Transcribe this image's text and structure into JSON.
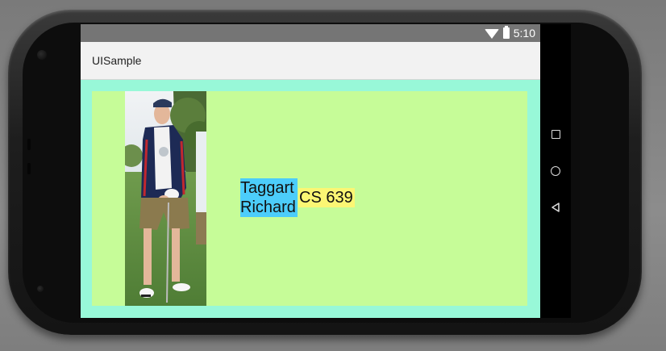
{
  "status_bar": {
    "time": "5:10",
    "icons": [
      "wifi-icon",
      "battery-icon"
    ]
  },
  "app_bar": {
    "title": "UISample"
  },
  "profile": {
    "first_name": "Taggart",
    "last_name": "Richard",
    "course": "CS 639"
  },
  "colors": {
    "outer_background": "#98f8d8",
    "card_background": "#c6fc98",
    "name_highlight": "#4ccdfb",
    "course_highlight": "#fbf674",
    "status_bar": "#757575",
    "app_bar": "#f2f2f2"
  },
  "navigation": {
    "buttons": [
      "recents-icon",
      "home-icon",
      "back-icon"
    ]
  }
}
